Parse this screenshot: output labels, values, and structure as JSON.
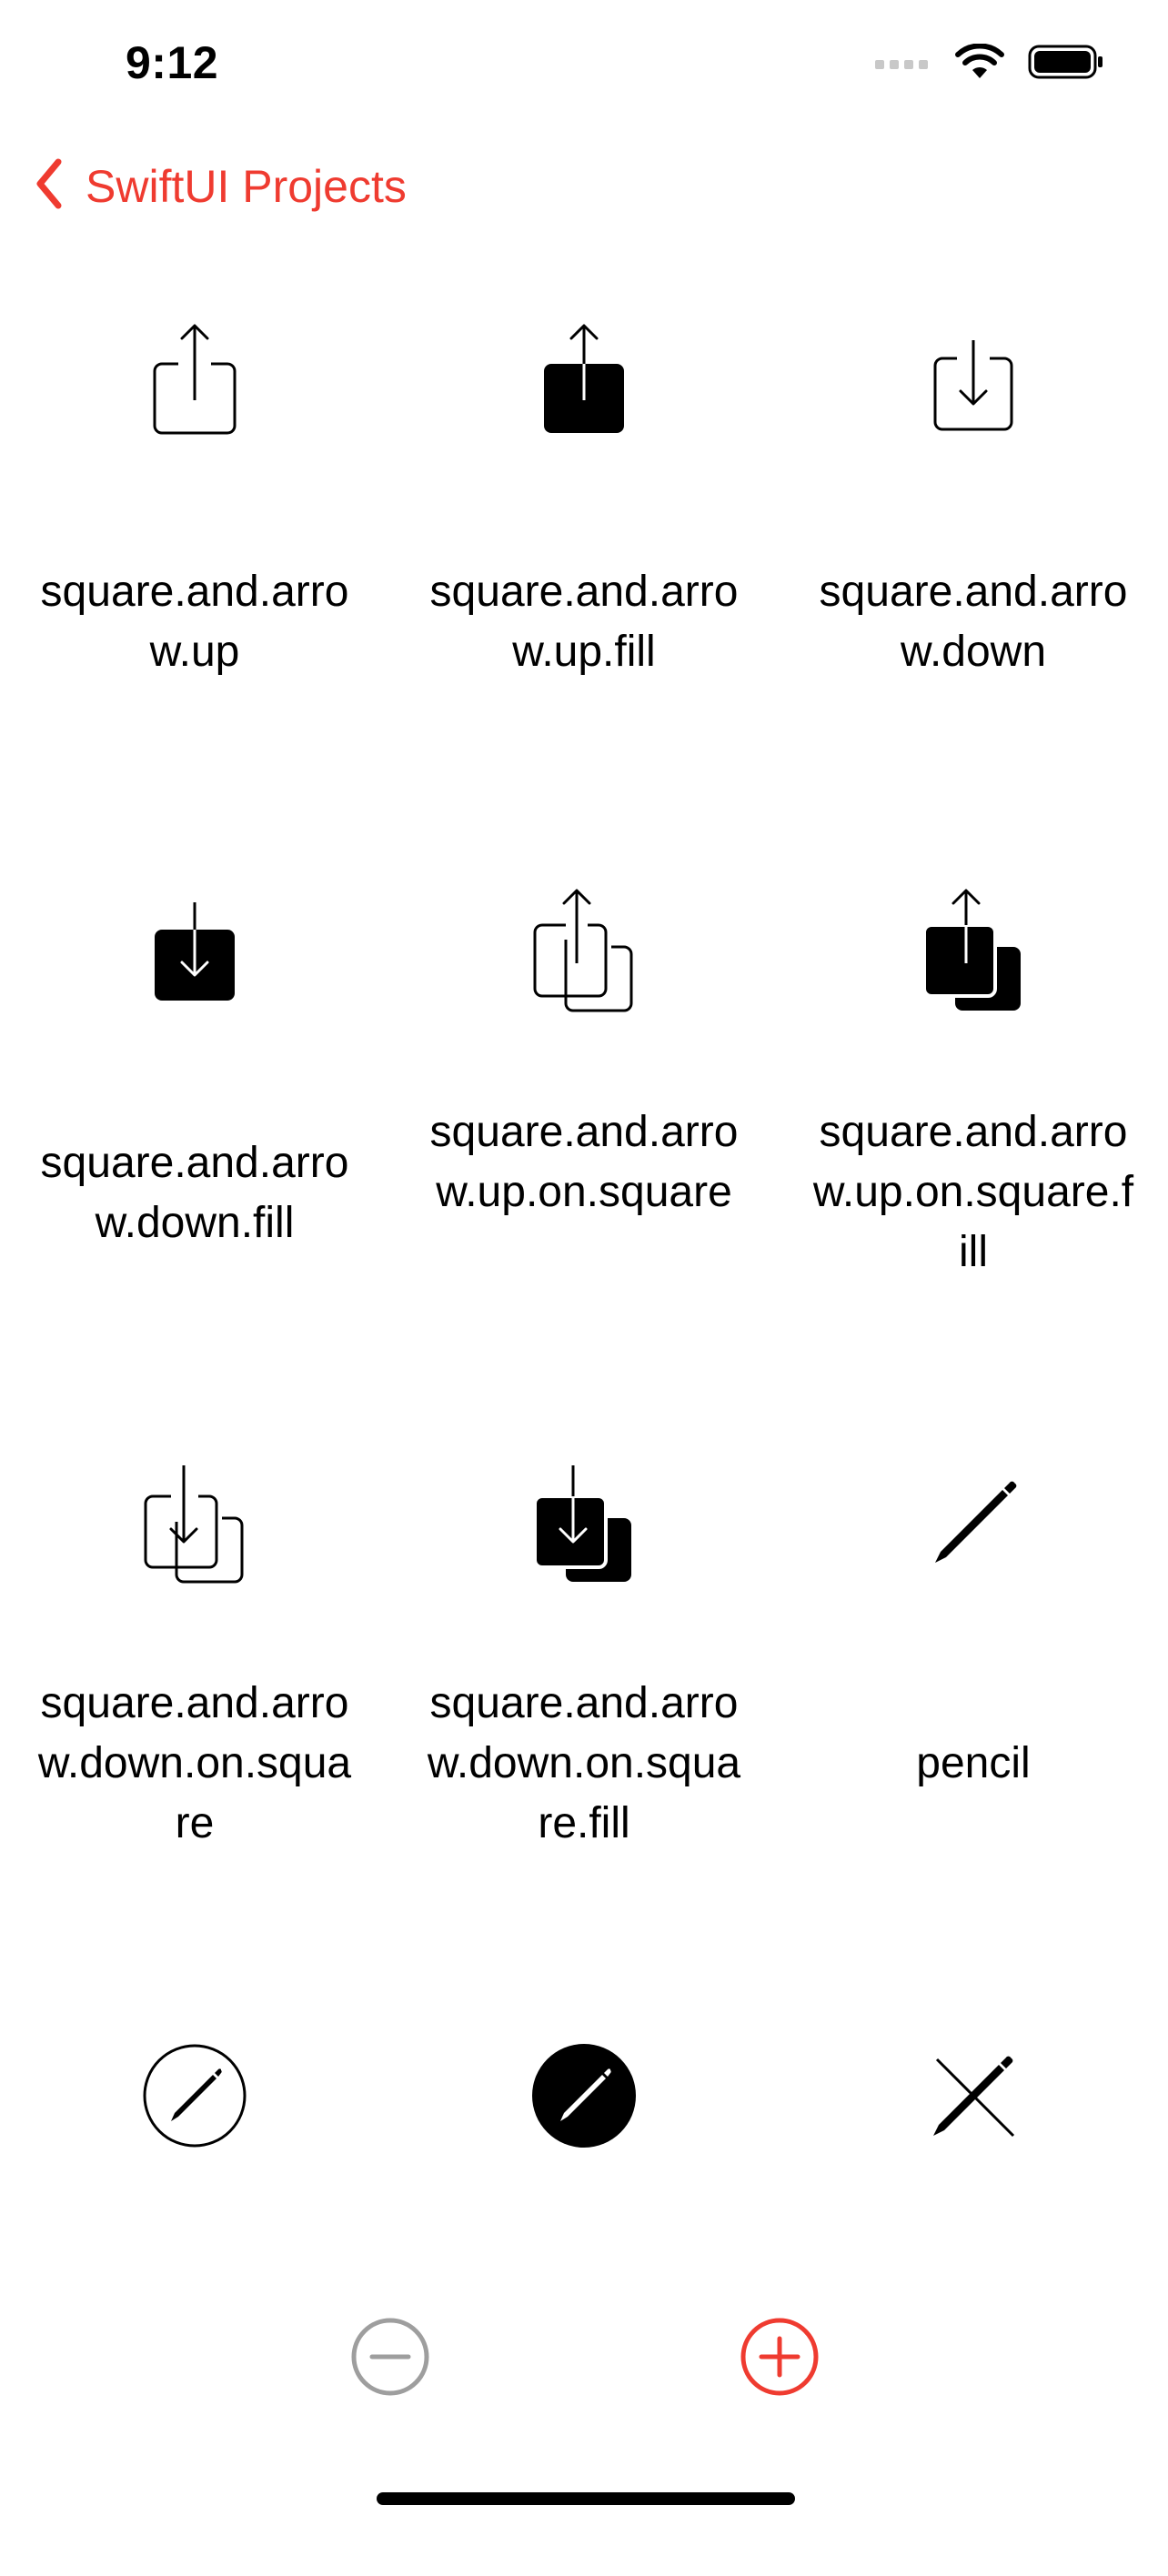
{
  "status_bar": {
    "time": "9:12",
    "icons": [
      "cellular-signal-icon",
      "wifi-icon",
      "battery-icon"
    ]
  },
  "nav": {
    "back_label": "SwiftUI Projects",
    "accent_color": "#ef3b30"
  },
  "symbols": [
    {
      "name": "square.and.arrow.up",
      "icon": "square-and-arrow-up-icon"
    },
    {
      "name": "square.and.arrow.up.fill",
      "icon": "square-and-arrow-up-fill-icon"
    },
    {
      "name": "square.and.arrow.down",
      "icon": "square-and-arrow-down-icon"
    },
    {
      "name": "square.and.arrow.down.fill",
      "icon": "square-and-arrow-down-fill-icon"
    },
    {
      "name": "square.and.arrow.up.on.square",
      "icon": "square-and-arrow-up-on-square-icon"
    },
    {
      "name": "square.and.arrow.up.on.square.fill",
      "icon": "square-and-arrow-up-on-square-fill-icon"
    },
    {
      "name": "square.and.arrow.down.on.square",
      "icon": "square-and-arrow-down-on-square-icon"
    },
    {
      "name": "square.and.arrow.down.on.square.fill",
      "icon": "square-and-arrow-down-on-square-fill-icon"
    },
    {
      "name": "pencil",
      "icon": "pencil-icon"
    },
    {
      "name": "",
      "icon": "pencil-circle-icon"
    },
    {
      "name": "",
      "icon": "pencil-circle-fill-icon"
    },
    {
      "name": "",
      "icon": "pencil-slash-icon"
    }
  ],
  "toolbar": {
    "minus_icon": "minus-circle-icon",
    "plus_icon": "plus-circle-icon",
    "minus_color": "#9e9e9e",
    "plus_color": "#ef3b30"
  }
}
